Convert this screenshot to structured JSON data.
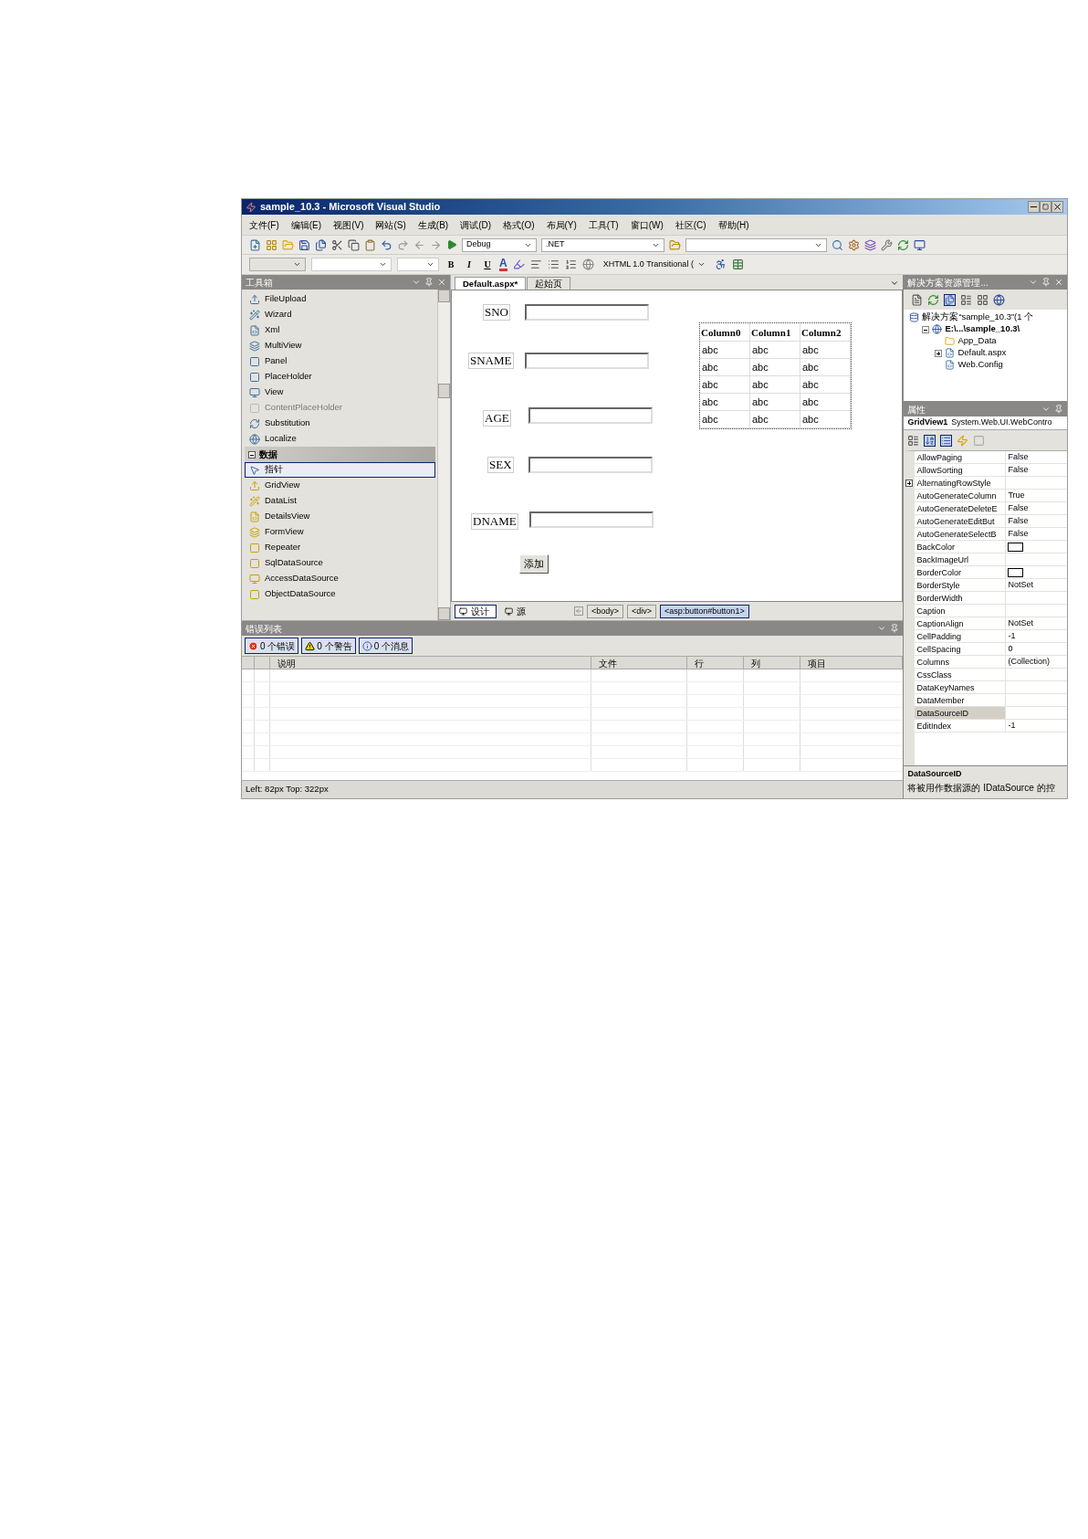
{
  "window": {
    "title": "sample_10.3 - Microsoft Visual Studio"
  },
  "menu": [
    "文件(F)",
    "编辑(E)",
    "视图(V)",
    "网站(S)",
    "生成(B)",
    "调试(D)",
    "格式(O)",
    "布局(Y)",
    "工具(T)",
    "窗口(W)",
    "社区(C)",
    "帮助(H)"
  ],
  "toolbar": {
    "configuration": "Debug",
    "platform": ".NET",
    "format_buttons": [
      "B",
      "I",
      "U"
    ],
    "text_color": "A",
    "doctype": "XHTML 1.0 Transitional ("
  },
  "toolbox": {
    "title": "工具箱",
    "items": [
      {
        "kind": "item",
        "label": "FileUpload",
        "disabled": false,
        "selected": false
      },
      {
        "kind": "item",
        "label": "Wizard",
        "disabled": false,
        "selected": false
      },
      {
        "kind": "item",
        "label": "Xml",
        "disabled": false,
        "selected": false
      },
      {
        "kind": "item",
        "label": "MultiView",
        "disabled": false,
        "selected": false
      },
      {
        "kind": "item",
        "label": "Panel",
        "disabled": false,
        "selected": false
      },
      {
        "kind": "item",
        "label": "PlaceHolder",
        "disabled": false,
        "selected": false
      },
      {
        "kind": "item",
        "label": "View",
        "disabled": false,
        "selected": false
      },
      {
        "kind": "item",
        "label": "ContentPlaceHolder",
        "disabled": true,
        "selected": false
      },
      {
        "kind": "item",
        "label": "Substitution",
        "disabled": false,
        "selected": false
      },
      {
        "kind": "item",
        "label": "Localize",
        "disabled": false,
        "selected": false
      },
      {
        "kind": "group",
        "label": "数据",
        "expanded": true
      },
      {
        "kind": "pointer",
        "label": "指针",
        "disabled": false,
        "selected": true
      },
      {
        "kind": "item",
        "label": "GridView",
        "disabled": false,
        "selected": false
      },
      {
        "kind": "item",
        "label": "DataList",
        "disabled": false,
        "selected": false
      },
      {
        "kind": "item",
        "label": "DetailsView",
        "disabled": false,
        "selected": false
      },
      {
        "kind": "item",
        "label": "FormView",
        "disabled": false,
        "selected": false
      },
      {
        "kind": "item",
        "label": "Repeater",
        "disabled": false,
        "selected": false
      },
      {
        "kind": "item",
        "label": "SqlDataSource",
        "disabled": false,
        "selected": false
      },
      {
        "kind": "item",
        "label": "AccessDataSource",
        "disabled": false,
        "selected": false
      },
      {
        "kind": "item",
        "label": "ObjectDataSource",
        "disabled": false,
        "selected": false
      }
    ]
  },
  "designer": {
    "tabs": [
      {
        "label": "Default.aspx*",
        "selected": true
      },
      {
        "label": "起始页",
        "selected": false
      }
    ],
    "fields": [
      {
        "label": "SNO"
      },
      {
        "label": "SNAME"
      },
      {
        "label": "AGE"
      },
      {
        "label": "SEX"
      },
      {
        "label": "DNAME"
      }
    ],
    "button": "添加",
    "grid": {
      "columns": [
        "Column0",
        "Column1",
        "Column2"
      ],
      "rows": [
        [
          "abc",
          "abc",
          "abc"
        ],
        [
          "abc",
          "abc",
          "abc"
        ],
        [
          "abc",
          "abc",
          "abc"
        ],
        [
          "abc",
          "abc",
          "abc"
        ],
        [
          "abc",
          "abc",
          "abc"
        ]
      ]
    },
    "views": [
      {
        "label": "设计",
        "selected": true
      },
      {
        "label": "源",
        "selected": false
      }
    ],
    "breadcrumbs": [
      {
        "label": "<body>",
        "selected": false
      },
      {
        "label": "<div>",
        "selected": false
      },
      {
        "label": "<asp:button#button1>",
        "selected": true
      }
    ]
  },
  "solution_explorer": {
    "title": "解决方案资源管理...",
    "tree": [
      {
        "label": "解决方案“sample_10.3”(1 个",
        "children": [
          {
            "label": "E:\\...\\sample_10.3\\",
            "expanded": true,
            "children": [
              {
                "label": "App_Data"
              },
              {
                "label": "Default.aspx",
                "expanded": false
              },
              {
                "label": "Web.Config"
              }
            ]
          }
        ]
      }
    ]
  },
  "properties": {
    "title": "属性",
    "object_name": "GridView1",
    "object_type": "System.Web.UI.WebContro",
    "rows": [
      {
        "name": "AllowPaging",
        "value": "False",
        "kind": "text",
        "selected": false
      },
      {
        "name": "AllowSorting",
        "value": "False",
        "kind": "text",
        "selected": false
      },
      {
        "name": "AlternatingRowStyle",
        "kind": "group",
        "selected": false
      },
      {
        "name": "AutoGenerateColumn",
        "value": "True",
        "kind": "text",
        "selected": false
      },
      {
        "name": "AutoGenerateDeleteE",
        "value": "False",
        "kind": "text",
        "selected": false
      },
      {
        "name": "AutoGenerateEditBut",
        "value": "False",
        "kind": "text",
        "selected": false
      },
      {
        "name": "AutoGenerateSelectB",
        "value": "False",
        "kind": "text",
        "selected": false
      },
      {
        "name": "BackColor",
        "kind": "color",
        "selected": false
      },
      {
        "name": "BackImageUrl",
        "kind": "text",
        "selected": false
      },
      {
        "name": "BorderColor",
        "kind": "color",
        "selected": false
      },
      {
        "name": "BorderStyle",
        "value": "NotSet",
        "kind": "text",
        "selected": false
      },
      {
        "name": "BorderWidth",
        "kind": "text",
        "selected": false
      },
      {
        "name": "Caption",
        "kind": "text",
        "selected": false
      },
      {
        "name": "CaptionAlign",
        "value": "NotSet",
        "kind": "text",
        "selected": false
      },
      {
        "name": "CellPadding",
        "value": "-1",
        "kind": "text",
        "selected": false
      },
      {
        "name": "CellSpacing",
        "value": "0",
        "kind": "text",
        "selected": false
      },
      {
        "name": "Columns",
        "value": "(Collection)",
        "kind": "text",
        "selected": false
      },
      {
        "name": "CssClass",
        "kind": "text",
        "selected": false
      },
      {
        "name": "DataKeyNames",
        "kind": "text",
        "selected": false
      },
      {
        "name": "DataMember",
        "kind": "text",
        "selected": false
      },
      {
        "name": "DataSourceID",
        "kind": "text",
        "selected": true
      },
      {
        "name": "EditIndex",
        "value": "-1",
        "kind": "text",
        "selected": false
      }
    ],
    "description_title": "DataSourceID",
    "description": "将被用作数据源的 IDataSource 的控"
  },
  "error_list": {
    "title": "错误列表",
    "filters": [
      {
        "kind": "error",
        "label": "0 个错误",
        "selected": true
      },
      {
        "kind": "warning",
        "label": "0 个警告",
        "selected": true
      },
      {
        "kind": "info",
        "label": "0 个消息",
        "selected": true
      }
    ],
    "columns": [
      "说明",
      "文件",
      "行",
      "列",
      "项目"
    ]
  },
  "status_bar": "Left: 82px Top: 322px"
}
